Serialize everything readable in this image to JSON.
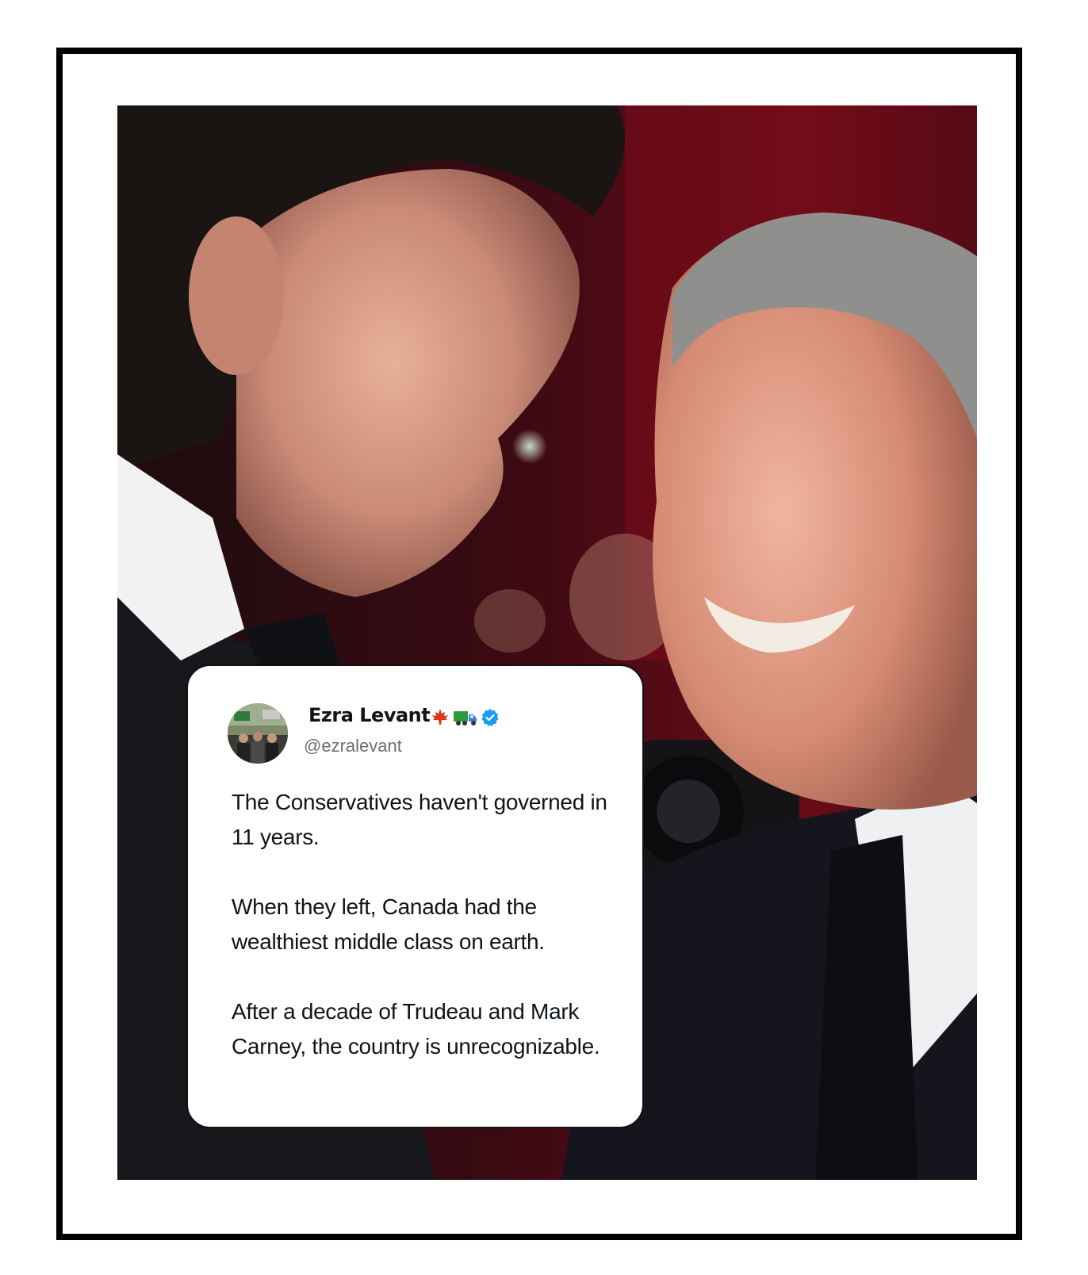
{
  "tweet": {
    "author_name": "Ezra Levant",
    "name_icons": [
      "maple-leaf-emoji",
      "truck-emoji",
      "verified-badge-icon"
    ],
    "handle": "@ezralevant",
    "paragraphs": [
      "The Conservatives haven't governed in 11 years.",
      "When they left, Canada had the wealthiest middle class on earth.",
      "After a decade of Trudeau and Mark Carney, the country is unrecognizable."
    ]
  },
  "colors": {
    "frame_border": "#000000",
    "verified_blue": "#1d9bf0",
    "text_primary": "#0f1419",
    "text_secondary": "#6b6f73",
    "maple_red": "#d9361e",
    "truck_green": "#2e9a3a"
  }
}
